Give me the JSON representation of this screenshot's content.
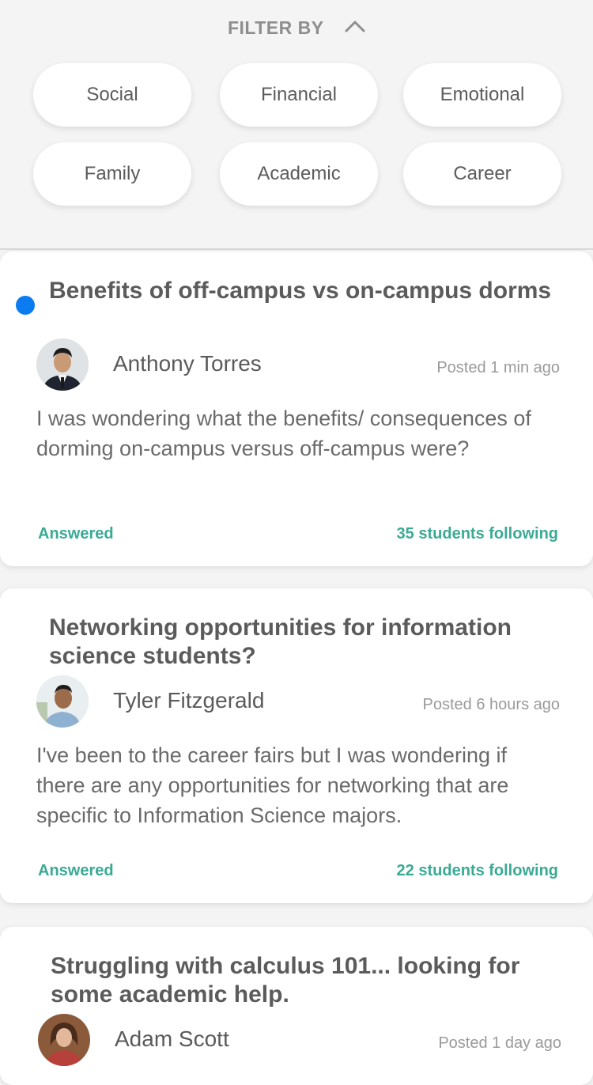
{
  "filter": {
    "label": "FILTER BY",
    "chips": [
      "Social",
      "Financial",
      "Emotional",
      "Family",
      "Academic",
      "Career"
    ]
  },
  "posts": [
    {
      "title": "Benefits of off-campus vs on-campus dorms",
      "author": "Anthony Torres",
      "posted": "Posted 1 min ago",
      "body": "I was wondering what the benefits/ consequences of dorming on-campus versus off-campus were?",
      "status": "Answered",
      "following": "35 students following",
      "unread": true
    },
    {
      "title": "Networking opportunities for information science students?",
      "author": "Tyler Fitzgerald",
      "posted": "Posted 6 hours ago",
      "body": "I've been to the career fairs but I was wondering if there are any opportunities for networking that are specific to Information Science majors.",
      "status": "Answered",
      "following": "22 students following",
      "unread": false
    },
    {
      "title": "Struggling with calculus 101... looking for some academic help.",
      "author": "Adam Scott",
      "posted": "Posted 1 day ago",
      "unread": false
    }
  ],
  "colors": {
    "accent_green": "#3aaa94",
    "unread_blue": "#0a7cf0"
  }
}
